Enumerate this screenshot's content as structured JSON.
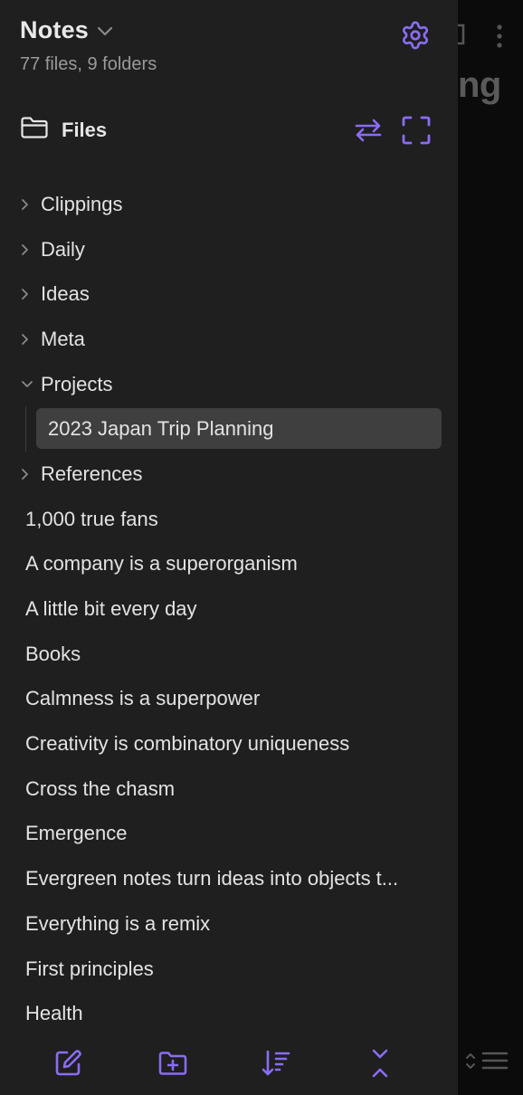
{
  "vault": {
    "name": "Notes",
    "stats": "77 files, 9 folders"
  },
  "files_header": {
    "label": "Files"
  },
  "background": {
    "title_fragment": "ng"
  },
  "colors": {
    "accent": "#8b6cf6",
    "drawer_bg": "#1f1f1f",
    "selected_bg": "#3f3f3f",
    "text": "#e3e3e3",
    "muted_text": "#9a9a9a"
  },
  "tree": {
    "folders": [
      {
        "label": "Clippings",
        "expanded": false
      },
      {
        "label": "Daily",
        "expanded": false
      },
      {
        "label": "Ideas",
        "expanded": false
      },
      {
        "label": "Meta",
        "expanded": false
      },
      {
        "label": "Projects",
        "expanded": true
      }
    ],
    "selected_child": {
      "label": "2023 Japan Trip Planning"
    },
    "folders_after": [
      {
        "label": "References",
        "expanded": false
      }
    ],
    "files": [
      "1,000 true fans",
      "A company is a superorganism",
      "A little bit every day",
      "Books",
      "Calmness is a superpower",
      "Creativity is combinatory uniqueness",
      "Cross the chasm",
      "Emergence",
      "Evergreen notes turn ideas into objects t...",
      "Everything is a remix",
      "First principles",
      "Health"
    ]
  },
  "icons": {
    "vault_switch": "chevron-down-icon",
    "settings": "gear-icon",
    "files": "folder-icon",
    "reveal_active_file": "swap-arrows-icon",
    "expand_view": "expand-corners-icon",
    "new_note": "edit-icon",
    "new_folder": "folder-plus-icon",
    "sort": "sort-icon",
    "collapse_all": "collapse-all-icon"
  }
}
